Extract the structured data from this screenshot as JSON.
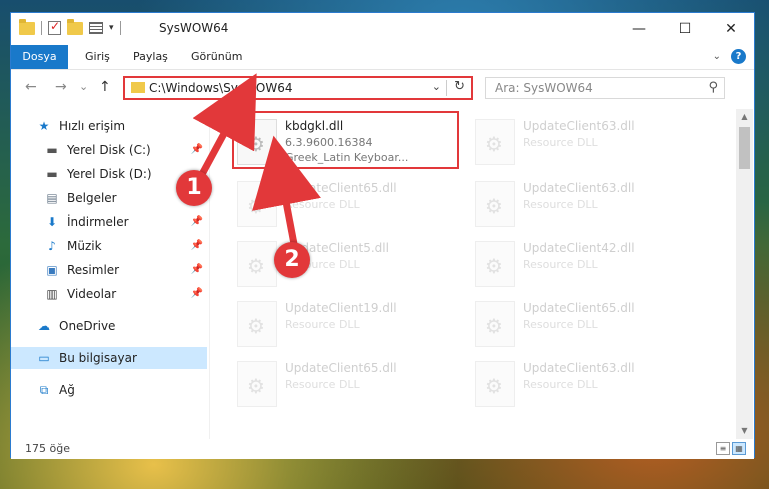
{
  "window": {
    "title": "SysWOW64",
    "controls": {
      "minimize": "—",
      "maximize": "☐",
      "close": "✕"
    }
  },
  "ribbon": {
    "tabs": [
      "Dosya",
      "Giriş",
      "Paylaş",
      "Görünüm"
    ],
    "help": "?"
  },
  "nav": {
    "back": "←",
    "forward": "→",
    "recent": "⌄",
    "up": "↑"
  },
  "address": {
    "path": "C:\\Windows\\SysWOW64"
  },
  "search": {
    "placeholder": "Ara: SysWOW64"
  },
  "sidebar": {
    "items": [
      {
        "label": "Hızlı erişim",
        "icon": "star-icon",
        "pinned": false
      },
      {
        "label": "Yerel Disk (C:)",
        "icon": "drive-icon",
        "pinned": true
      },
      {
        "label": "Yerel Disk (D:)",
        "icon": "drive-icon",
        "pinned": false
      },
      {
        "label": "Belgeler",
        "icon": "documents-icon",
        "pinned": true
      },
      {
        "label": "İndirmeler",
        "icon": "download-icon",
        "pinned": true
      },
      {
        "label": "Müzik",
        "icon": "music-icon",
        "pinned": true
      },
      {
        "label": "Resimler",
        "icon": "pictures-icon",
        "pinned": true
      },
      {
        "label": "Videolar",
        "icon": "video-icon",
        "pinned": true
      },
      {
        "label": "OneDrive",
        "icon": "cloud-icon",
        "pinned": false
      },
      {
        "label": "Bu bilgisayar",
        "icon": "computer-icon",
        "pinned": false
      },
      {
        "label": "Ağ",
        "icon": "network-icon",
        "pinned": false
      }
    ]
  },
  "files": [
    {
      "name": "kbdgkl.dll",
      "sub1": "6.3.9600.16384",
      "sub2": "Greek_Latin Keyboar...",
      "faded": false
    },
    {
      "name": "UpdateClient63.dll",
      "sub1": "Resource DLL",
      "faded": true
    },
    {
      "name": "UpdateClient65.dll",
      "sub1": "Resource DLL",
      "faded": true
    },
    {
      "name": "UpdateClient63.dll",
      "sub1": "Resource DLL",
      "faded": true
    },
    {
      "name": "UpdateClient5.dll",
      "sub1": "Resource DLL",
      "faded": true
    },
    {
      "name": "UpdateClient42.dll",
      "sub1": "Resource DLL",
      "faded": true
    },
    {
      "name": "UpdateClient19.dll",
      "sub1": "Resource DLL",
      "faded": true
    },
    {
      "name": "UpdateClient65.dll",
      "sub1": "Resource DLL",
      "faded": true
    },
    {
      "name": "UpdateClient65.dll",
      "sub1": "Resource DLL",
      "faded": true
    },
    {
      "name": "UpdateClient63.dll",
      "sub1": "Resource DLL",
      "faded": true
    }
  ],
  "status": {
    "count": "175 öğe"
  },
  "callouts": [
    "1",
    "2"
  ],
  "colors": {
    "accent": "#1979ca",
    "highlight": "#e2383a",
    "selected": "#cce8ff"
  }
}
